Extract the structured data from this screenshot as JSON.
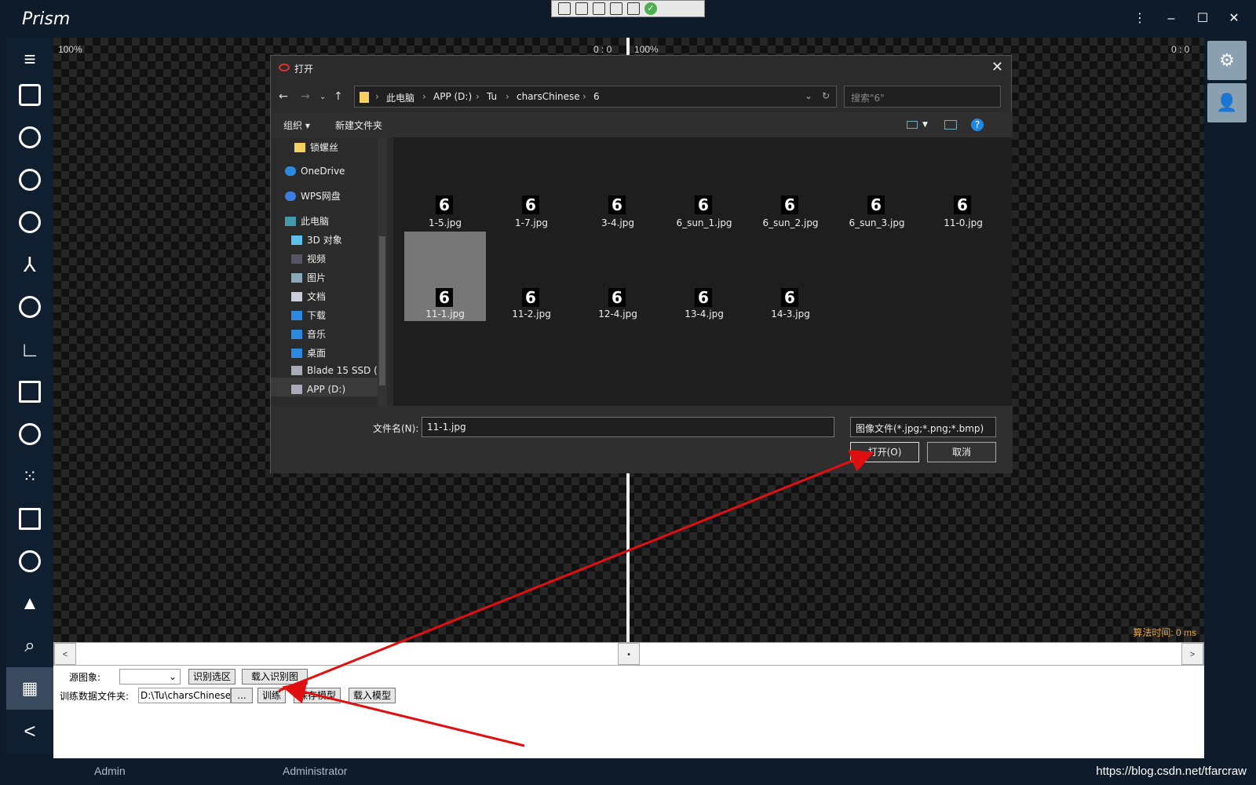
{
  "app": {
    "title": "Prism"
  },
  "canvas": {
    "left_zoom": "100%",
    "left_ratio": "0 : 0",
    "right_zoom": "100%",
    "right_ratio": "0 : 0",
    "algo_time": "算法时间: 0 ms"
  },
  "scroll": {
    "left_label": "<",
    "right_label": ">",
    "thumb_label": "•"
  },
  "panel": {
    "source_label": "源图象:",
    "recognize_region": "识别选区",
    "load_recognize": "载入识别图",
    "train_folder_label": "训练数据文件夹:",
    "train_folder_value": "D:\\Tu\\charsChinese\\",
    "browse": "...",
    "train": "训练",
    "save_model": "保存模型",
    "load_model": "载入模型"
  },
  "status": {
    "user1": "Admin",
    "user2": "Administrator",
    "url": "https://blog.csdn.net/tfarcraw"
  },
  "dialog": {
    "title": "打开",
    "close": "✕",
    "breadcrumb": [
      "此电脑",
      "APP (D:)",
      "Tu",
      "charsChinese",
      "6"
    ],
    "search_placeholder": "搜索\"6\"",
    "organize": "组织 ▾",
    "new_folder": "新建文件夹",
    "tree": [
      {
        "label": "锁螺丝",
        "icon": "folder-icon"
      },
      {
        "label": "OneDrive",
        "icon": "cloud-icon"
      },
      {
        "label": "WPS网盘",
        "icon": "cloud-icon"
      },
      {
        "label": "此电脑",
        "icon": "computer-icon"
      },
      {
        "label": "3D 对象",
        "icon": "cube-icon"
      },
      {
        "label": "视频",
        "icon": "video-icon"
      },
      {
        "label": "图片",
        "icon": "image-icon"
      },
      {
        "label": "文档",
        "icon": "document-icon"
      },
      {
        "label": "下载",
        "icon": "download-icon"
      },
      {
        "label": "音乐",
        "icon": "music-icon"
      },
      {
        "label": "桌面",
        "icon": "desktop-icon"
      },
      {
        "label": "Blade 15 SSD (",
        "icon": "drive-icon"
      },
      {
        "label": "APP (D:)",
        "icon": "drive-icon"
      }
    ],
    "files": [
      {
        "name": "1-5.jpg",
        "glyph": "6"
      },
      {
        "name": "1-7.jpg",
        "glyph": "6"
      },
      {
        "name": "3-4.jpg",
        "glyph": "6"
      },
      {
        "name": "6_sun_1.jpg",
        "glyph": "6"
      },
      {
        "name": "6_sun_2.jpg",
        "glyph": "6"
      },
      {
        "name": "6_sun_3.jpg",
        "glyph": "6"
      },
      {
        "name": "11-0.jpg",
        "glyph": "6"
      },
      {
        "name": "11-1.jpg",
        "glyph": "6",
        "selected": true
      },
      {
        "name": "11-2.jpg",
        "glyph": "6"
      },
      {
        "name": "12-4.jpg",
        "glyph": "6"
      },
      {
        "name": "13-4.jpg",
        "glyph": "6"
      },
      {
        "name": "14-3.jpg",
        "glyph": "6"
      }
    ],
    "filename_label": "文件名(N):",
    "filename_value": "11-1.jpg",
    "filter_value": "图像文件(*.jpg;*.png;*.bmp)",
    "open_button": "打开(O)",
    "cancel_button": "取消"
  },
  "colors": {
    "arrow": "#e01010",
    "accent": "#e8a84a"
  }
}
